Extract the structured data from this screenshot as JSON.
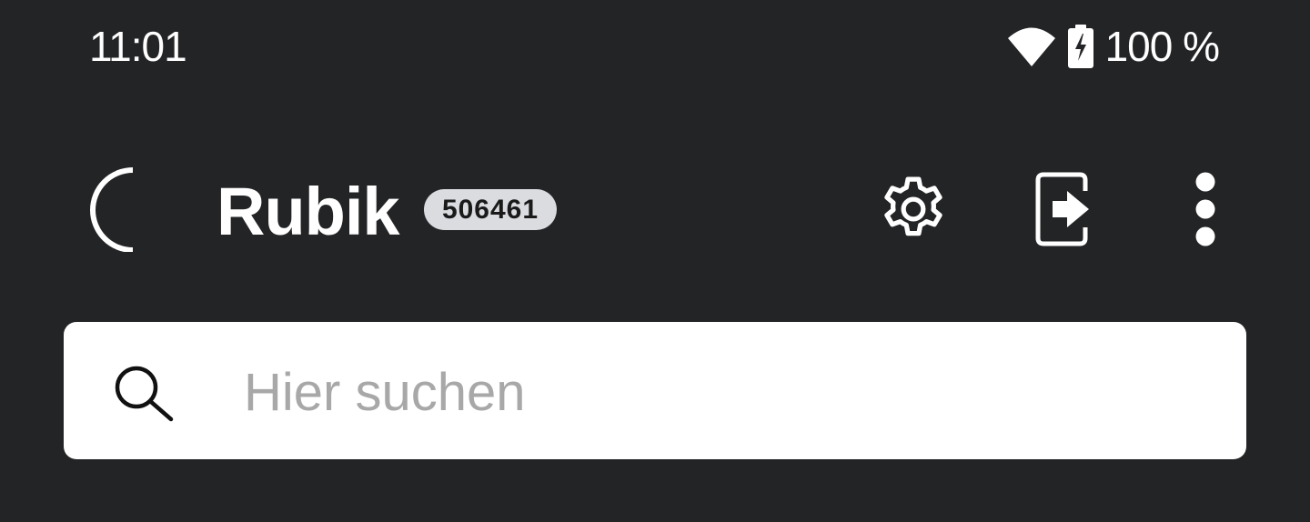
{
  "status_bar": {
    "time": "11:01",
    "battery_text": "100 %",
    "icons": [
      "wifi-icon",
      "battery-charging-icon"
    ]
  },
  "app_bar": {
    "logo": "rubik-logo",
    "title": "Rubik",
    "badge": "506461",
    "actions": [
      "settings-icon",
      "logout-icon",
      "more-vert-icon"
    ]
  },
  "search": {
    "placeholder": "Hier suchen",
    "value": "",
    "icon": "search-icon"
  },
  "colors": {
    "background": "#232426",
    "badge_bg": "#dadcdf",
    "search_bg": "#ffffff",
    "placeholder": "#a8a8a8"
  }
}
